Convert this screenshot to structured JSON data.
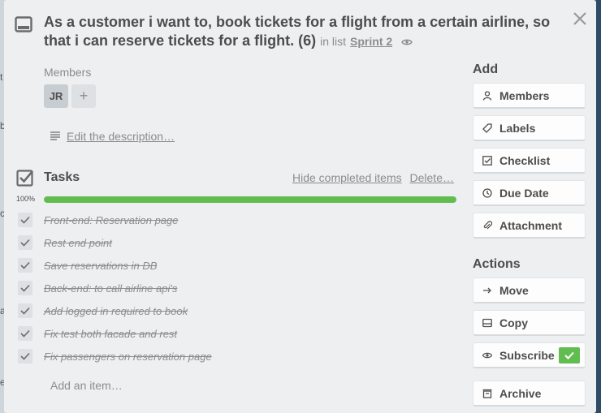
{
  "card": {
    "title": "As a customer i want to, book tickets for a flight from a certain airline, so that i can reserve tickets for a flight. (6)",
    "in_list_prefix": "in list",
    "list_name": "Sprint 2"
  },
  "members": {
    "label": "Members",
    "initials": "JR",
    "add_symbol": "+"
  },
  "description": {
    "link_text": "Edit the description…"
  },
  "tasks": {
    "title": "Tasks",
    "hide_label": "Hide completed items",
    "delete_label": "Delete…",
    "percent_text": "100%",
    "progress": 1.0,
    "items": [
      {
        "label": "Front-end: Reservation page",
        "done": true
      },
      {
        "label": "Rest end point",
        "done": true
      },
      {
        "label": "Save reservations in DB",
        "done": true
      },
      {
        "label": "Back-end: to call airline api's",
        "done": true
      },
      {
        "label": "Add logged in required to book",
        "done": true
      },
      {
        "label": "Fix test both facade and rest",
        "done": true
      },
      {
        "label": "Fix passengers on reservation page",
        "done": true
      }
    ],
    "add_item_placeholder": "Add an item…"
  },
  "sidebar": {
    "add_title": "Add",
    "add_buttons": [
      {
        "label": "Members",
        "icon": "person-icon"
      },
      {
        "label": "Labels",
        "icon": "tag-icon"
      },
      {
        "label": "Checklist",
        "icon": "checklist-icon"
      },
      {
        "label": "Due Date",
        "icon": "clock-icon"
      },
      {
        "label": "Attachment",
        "icon": "paperclip-icon"
      }
    ],
    "actions_title": "Actions",
    "action_buttons": [
      {
        "label": "Move",
        "icon": "arrow-right-icon"
      },
      {
        "label": "Copy",
        "icon": "copy-icon"
      },
      {
        "label": "Subscribe",
        "icon": "eye-icon",
        "subscribed": true
      },
      {
        "label": "Archive",
        "icon": "archive-icon"
      }
    ]
  },
  "colors": {
    "accent_green": "#61bd4f",
    "modal_bg": "#edeff0",
    "text_dark": "#4d4d4d",
    "text_muted": "#8c8c8c"
  }
}
